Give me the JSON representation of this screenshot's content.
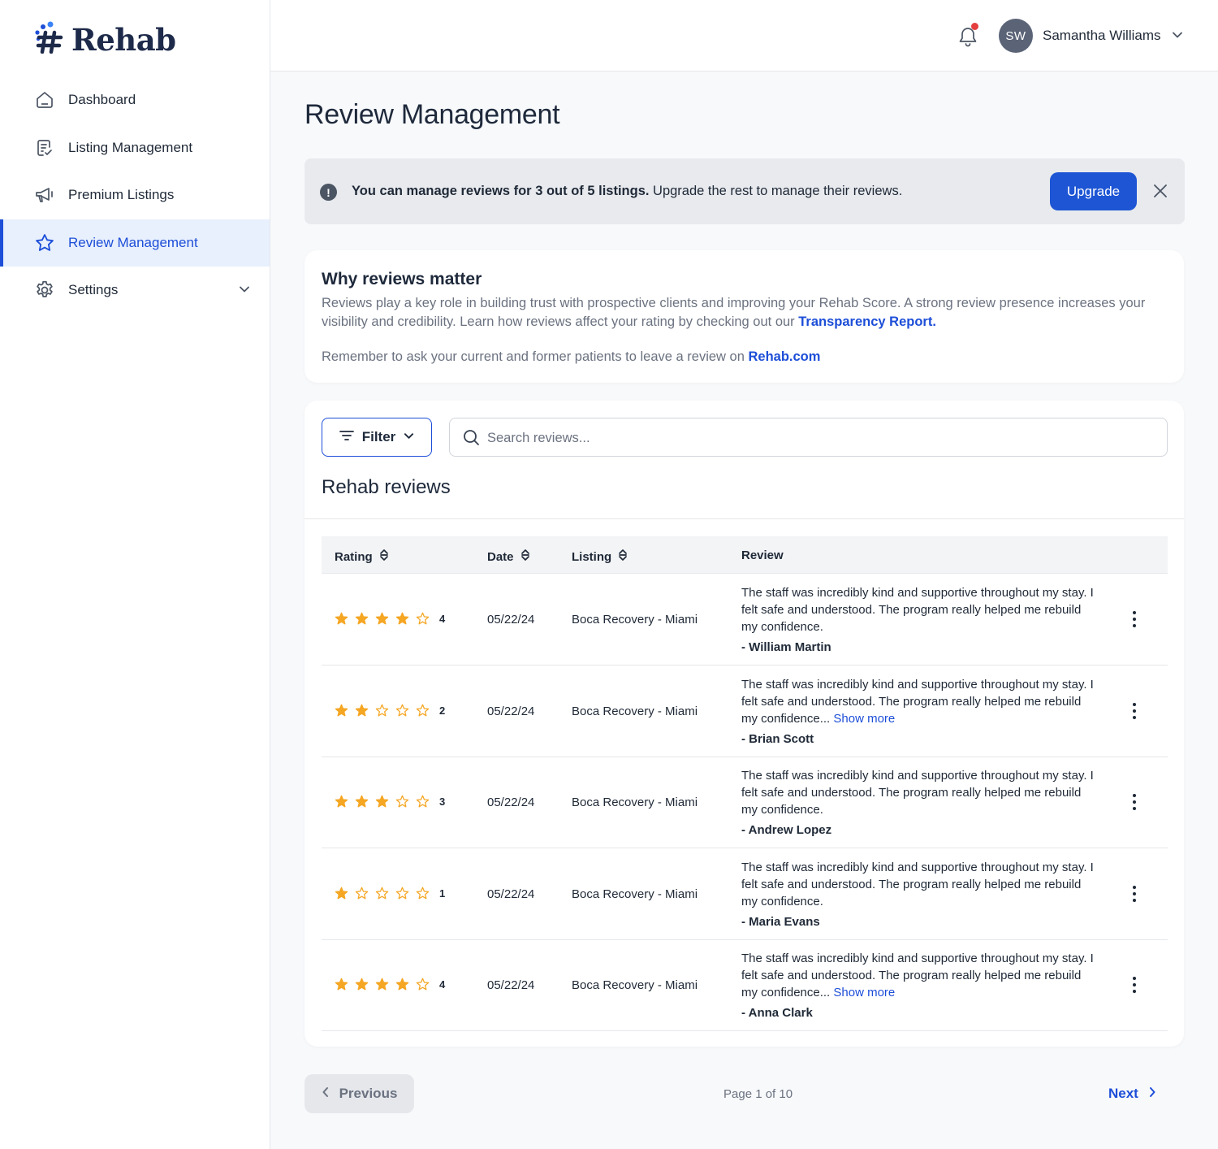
{
  "brand": {
    "name": "Rehab"
  },
  "sidebar": {
    "items": [
      {
        "label": "Dashboard",
        "icon": "home-icon"
      },
      {
        "label": "Listing Management",
        "icon": "clipboard-icon"
      },
      {
        "label": "Premium Listings",
        "icon": "megaphone-icon"
      },
      {
        "label": "Review Management",
        "icon": "star-icon",
        "active": true
      },
      {
        "label": "Settings",
        "icon": "gear-icon"
      }
    ]
  },
  "header": {
    "user": {
      "initials": "SW",
      "name": "Samantha Williams"
    }
  },
  "page": {
    "title": "Review Management"
  },
  "banner": {
    "bold_text": "You can manage reviews for 3 out of 5 listings.",
    "text": " Upgrade the rest to manage their reviews.",
    "button": "Upgrade"
  },
  "why": {
    "title": "Why reviews matter",
    "p1": "Reviews play a key role in building trust with prospective clients and improving your Rehab Score. A strong review presence increases your visibility and credibility.  Learn how reviews affect your rating by checking out our ",
    "p1_link": "Transparency Report.",
    "p2": "Remember to ask your current and former patients to leave a review on ",
    "p2_link": "Rehab.com"
  },
  "reviews": {
    "filter_label": "Filter",
    "search_placeholder": "Search reviews...",
    "title": "Rehab reviews",
    "columns": {
      "rating": "Rating",
      "date": "Date",
      "listing": "Listing",
      "review": "Review"
    },
    "star_color": "#f5a623",
    "rows": [
      {
        "rating": 4,
        "date": "05/22/24",
        "listing": "Boca Recovery - Miami",
        "text": "The staff was incredibly kind and supportive throughout my stay. I felt safe and understood. The program really helped me rebuild my confidence.",
        "more": "",
        "author": "- William Martin"
      },
      {
        "rating": 2,
        "date": "05/22/24",
        "listing": "Boca Recovery - Miami",
        "text": "The staff was incredibly kind and supportive throughout my stay. I felt safe and understood. The program really helped me rebuild my confidence...",
        "more": " Show more",
        "author": "- Brian Scott"
      },
      {
        "rating": 3,
        "date": "05/22/24",
        "listing": "Boca Recovery - Miami",
        "text": "The staff was incredibly kind and supportive throughout my stay. I felt safe and understood. The program really helped me rebuild my confidence.",
        "more": "",
        "author": "- Andrew Lopez"
      },
      {
        "rating": 1,
        "date": "05/22/24",
        "listing": "Boca Recovery - Miami",
        "text": "The staff was incredibly kind and supportive throughout my stay. I felt safe and understood. The program really helped me rebuild my confidence.",
        "more": "",
        "author": "- Maria Evans"
      },
      {
        "rating": 4,
        "date": "05/22/24",
        "listing": "Boca Recovery - Miami",
        "text": "The staff was incredibly kind and supportive throughout my stay. I felt safe and understood. The program really helped me rebuild my confidence...",
        "more": " Show more",
        "author": "- Anna Clark"
      }
    ]
  },
  "pagination": {
    "previous": "Previous",
    "info": "Page 1 of 10",
    "next": "Next"
  }
}
